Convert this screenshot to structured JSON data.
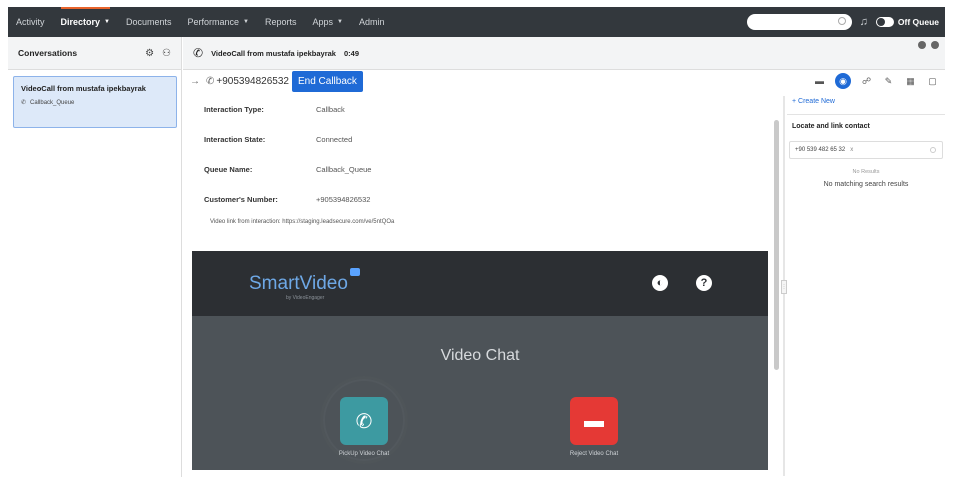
{
  "nav": {
    "items": [
      {
        "label": "Activity",
        "active": false,
        "caret": false
      },
      {
        "label": "Directory",
        "active": true,
        "caret": true
      },
      {
        "label": "Documents",
        "active": false,
        "caret": false
      },
      {
        "label": "Performance",
        "active": false,
        "caret": true
      },
      {
        "label": "Reports",
        "active": false,
        "caret": false
      },
      {
        "label": "Apps",
        "active": false,
        "caret": true
      },
      {
        "label": "Admin",
        "active": false,
        "caret": false
      }
    ],
    "queue_label": "Off Queue"
  },
  "sidebar": {
    "title": "Conversations",
    "card": {
      "title": "VideoCall from mustafa ipekbayrak",
      "queue": "Callback_Queue"
    }
  },
  "interaction": {
    "title": "VideoCall from mustafa ipekbayrak",
    "timer": "0:49",
    "callback_number": "+905394826532",
    "end_button": "End Callback"
  },
  "details": {
    "rows": [
      {
        "label": "Interaction Type:",
        "value": "Callback"
      },
      {
        "label": "Interaction State:",
        "value": "Connected"
      },
      {
        "label": "Queue Name:",
        "value": "Callback_Queue"
      },
      {
        "label": "Customer's Number:",
        "value": "+905394826532"
      }
    ],
    "video_link": "Video link from interaction:   https://staging.leadsecure.com/ve/5ntQOa"
  },
  "video": {
    "brand": "SmartVideo",
    "brand_sub": "by VideoEngager",
    "title": "Video Chat",
    "pickup_label": "PickUp Video Chat",
    "reject_label": "Reject Video Chat"
  },
  "contacts": {
    "create_new": "+ Create New",
    "title": "Locate and link contact",
    "search_value": "+90 539 482 65 32",
    "no_results": "No Results",
    "no_match": "No matching search results"
  },
  "colors": {
    "nav_bg": "#33383d",
    "accent": "#1f6ad6",
    "nav_active_bar": "#e8632b",
    "pickup": "#3d9aa1",
    "reject": "#e53935"
  }
}
